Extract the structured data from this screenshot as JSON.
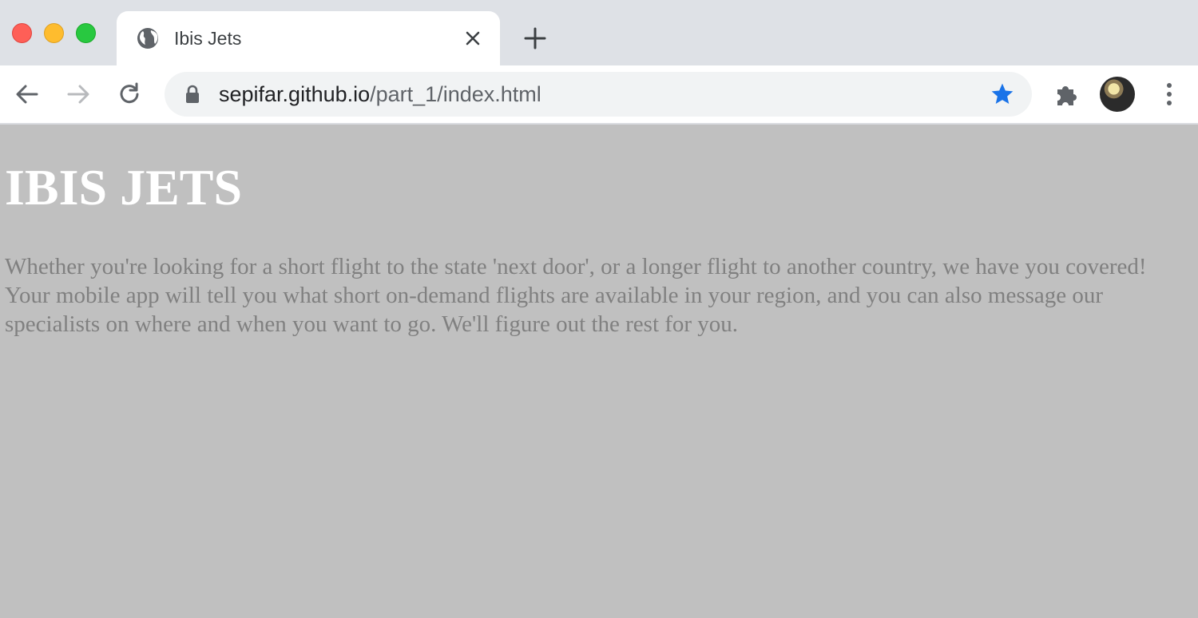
{
  "browser": {
    "tab": {
      "title": "Ibis Jets",
      "favicon": "globe-icon"
    },
    "address_bar": {
      "domain": "sepifar.github.io",
      "path": "/part_1/index.html"
    },
    "icons": {
      "back": "arrow-left-icon",
      "forward": "arrow-right-icon",
      "reload": "reload-icon",
      "lock": "lock-icon",
      "bookmark": "star-icon",
      "extensions": "puzzle-icon",
      "menu": "kebab-menu-icon"
    },
    "colors": {
      "bookmark_star": "#1a73e8",
      "tabstrip": "#dee1e6"
    }
  },
  "page": {
    "background": "#c0c0c0",
    "heading": "IBIS JETS",
    "paragraph": "Whether you're looking for a short flight to the state 'next door', or a longer flight to another country, we have you covered! Your mobile app will tell you what short on-demand flights are available in your region, and you can also message our specialists on where and when you want to go. We'll figure out the rest for you."
  }
}
